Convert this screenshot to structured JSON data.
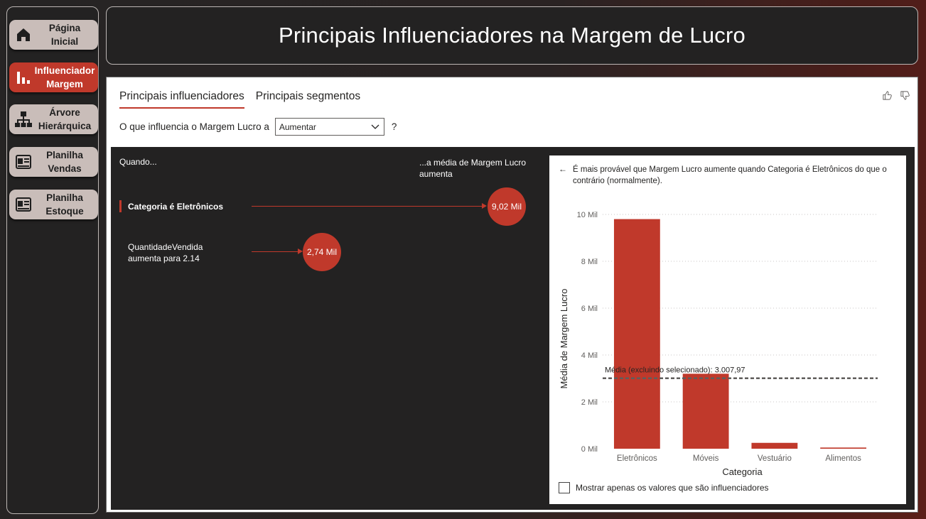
{
  "sidebar": {
    "items": [
      {
        "label": "Página\nInicial",
        "icon": "home-icon",
        "active": false
      },
      {
        "label": "Influenciador\nMargem",
        "icon": "bar-chart-icon",
        "active": true
      },
      {
        "label": "Árvore\nHierárquica",
        "icon": "hierarchy-icon",
        "active": false
      },
      {
        "label": "Planilha\nVendas",
        "icon": "spreadsheet-icon",
        "active": false
      },
      {
        "label": "Planilha\nEstoque",
        "icon": "spreadsheet-icon",
        "active": false
      }
    ]
  },
  "header": {
    "title": "Principais Influenciadores na Margem de Lucro"
  },
  "visual": {
    "tabs": [
      {
        "label": "Principais influenciadores",
        "active": true
      },
      {
        "label": "Principais segmentos",
        "active": false
      }
    ],
    "question_prefix": "O que influencia o Margem Lucro a",
    "select_value": "Aumentar",
    "question_mark": "?",
    "col_when": "Quando...",
    "col_avg": "...a média de Margem Lucro aumenta",
    "influencers": [
      {
        "label": "Categoria é Eletrônicos",
        "value": "9,02 Mil",
        "selected": true
      },
      {
        "label": "QuantidadeVendida aumenta para 2.14",
        "value": "2,74 Mil",
        "selected": false
      }
    ],
    "detail_text": "É mais provável que Margem Lucro aumente quando Categoria é Eletrônicos do que o contrário (normalmente).",
    "checkbox_label": "Mostrar apenas os valores que são influenciadores"
  },
  "chart_data": {
    "type": "bar",
    "categories": [
      "Eletrônicos",
      "Móveis",
      "Vestuário",
      "Alimentos"
    ],
    "values": [
      9800,
      3200,
      250,
      50
    ],
    "xlabel": "Categoria",
    "ylabel": "Média de Margem Lucro",
    "ylim": [
      0,
      10000
    ],
    "yticks": [
      "0 Mil",
      "2 Mil",
      "4 Mil",
      "6 Mil",
      "8 Mil",
      "10 Mil"
    ],
    "reference_line": {
      "label": "Média (excluindo selecionado): 3.007,97",
      "value": 3007.97
    },
    "bar_color": "#c0392b",
    "grid": true
  }
}
